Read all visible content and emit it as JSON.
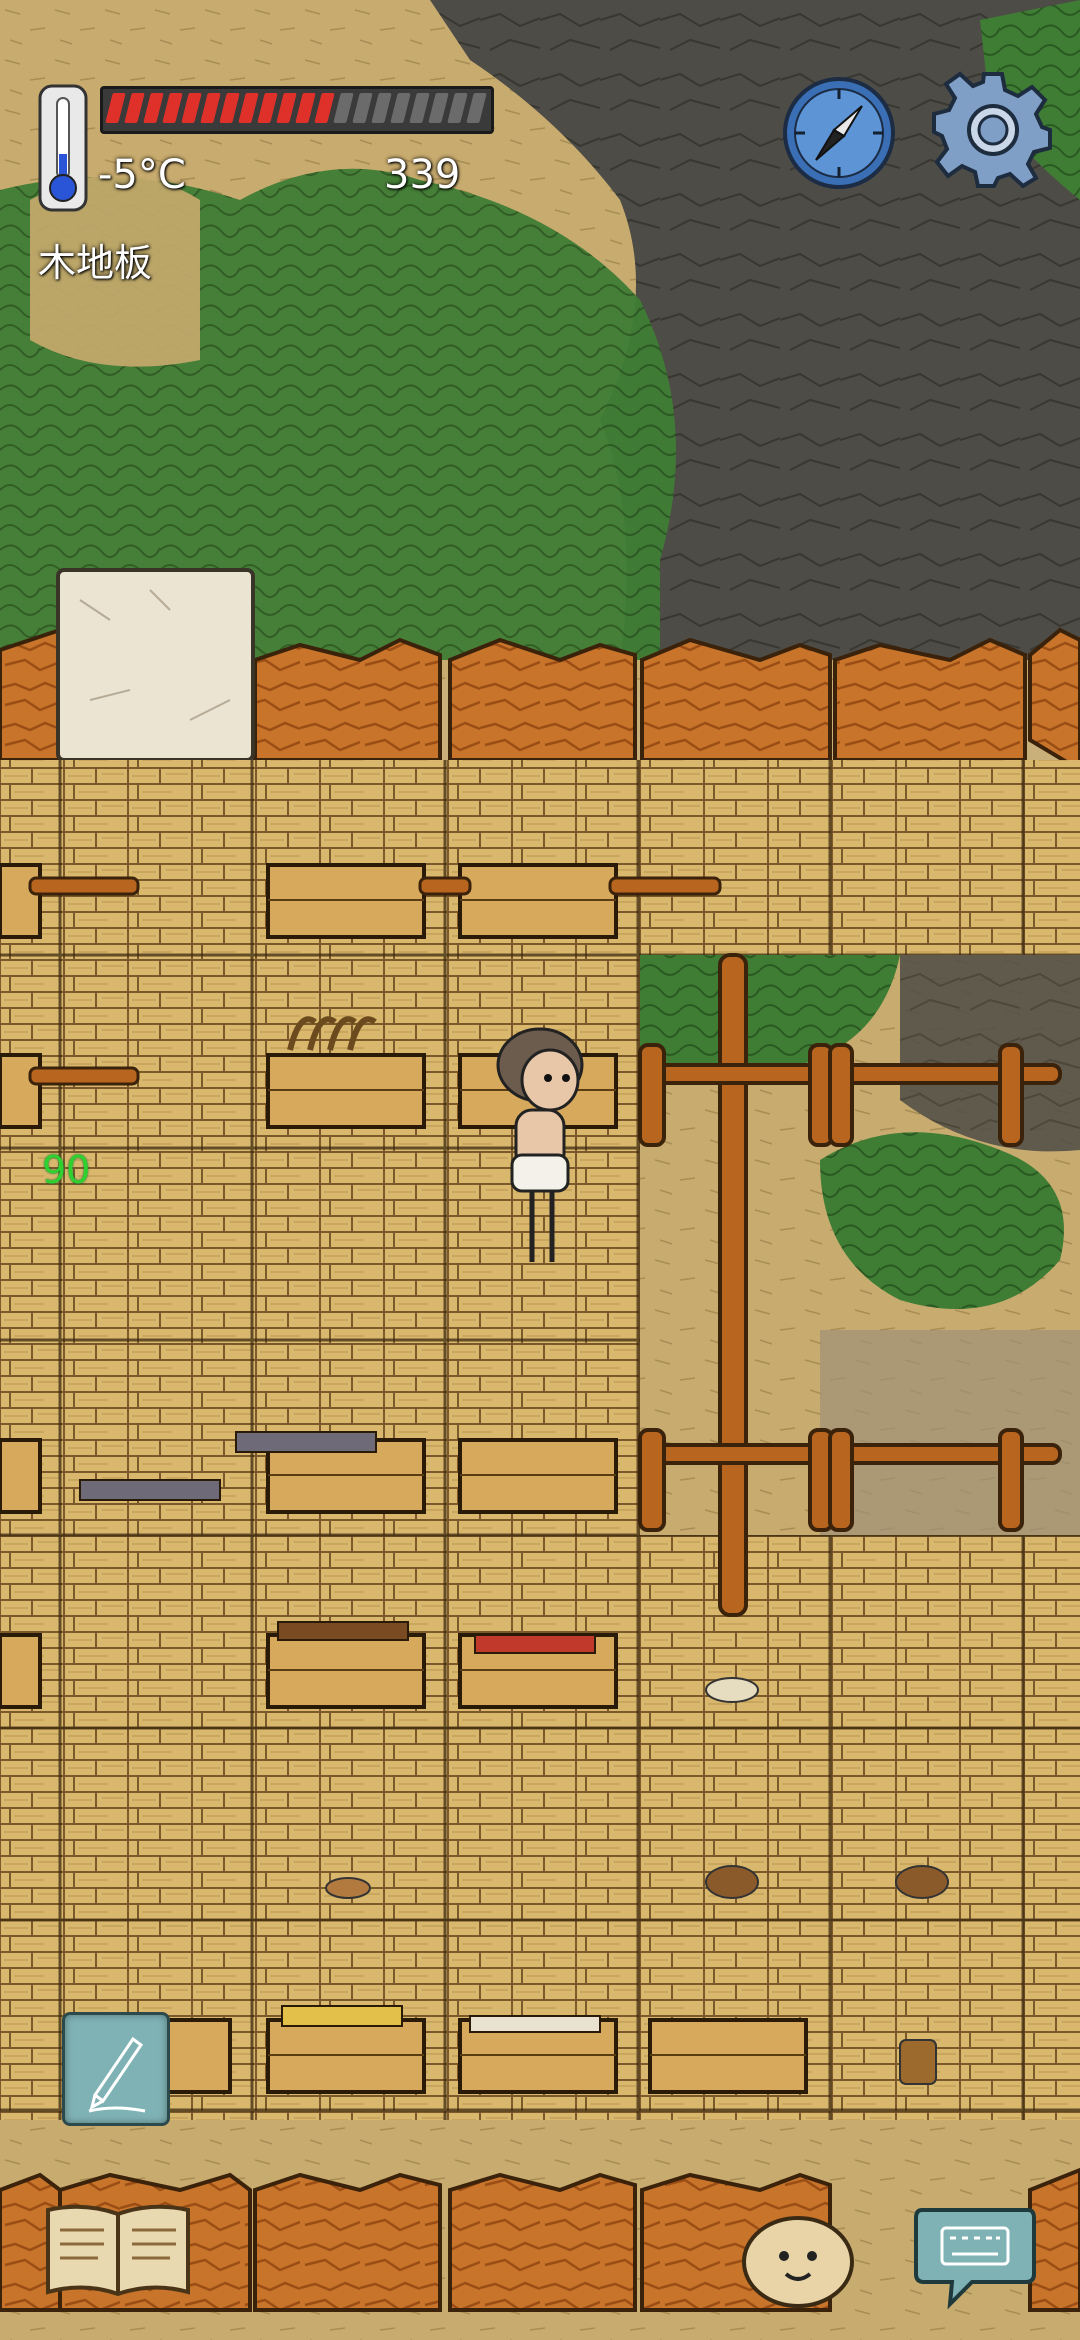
{
  "hud": {
    "temperature": "-5°C",
    "score": "339",
    "tile_name": "木地板",
    "health_fraction": 0.6,
    "health_segments_total": 20,
    "health_color": "#e0302a"
  },
  "world": {
    "floating_number": "90",
    "floating_number_color": "#2fd12f"
  },
  "icons": {
    "compass": "compass-icon",
    "settings": "gear-icon",
    "write": "pencil-icon",
    "recipe_book": "book-icon",
    "emote": "emote-face-icon",
    "keyboard": "keyboard-chat-icon",
    "thermometer": "thermometer-icon"
  },
  "colors": {
    "wood_floor": "#d8b56a",
    "wall": "#c9772a",
    "grass": "#3d7a33",
    "rock": "#4a4a44"
  }
}
